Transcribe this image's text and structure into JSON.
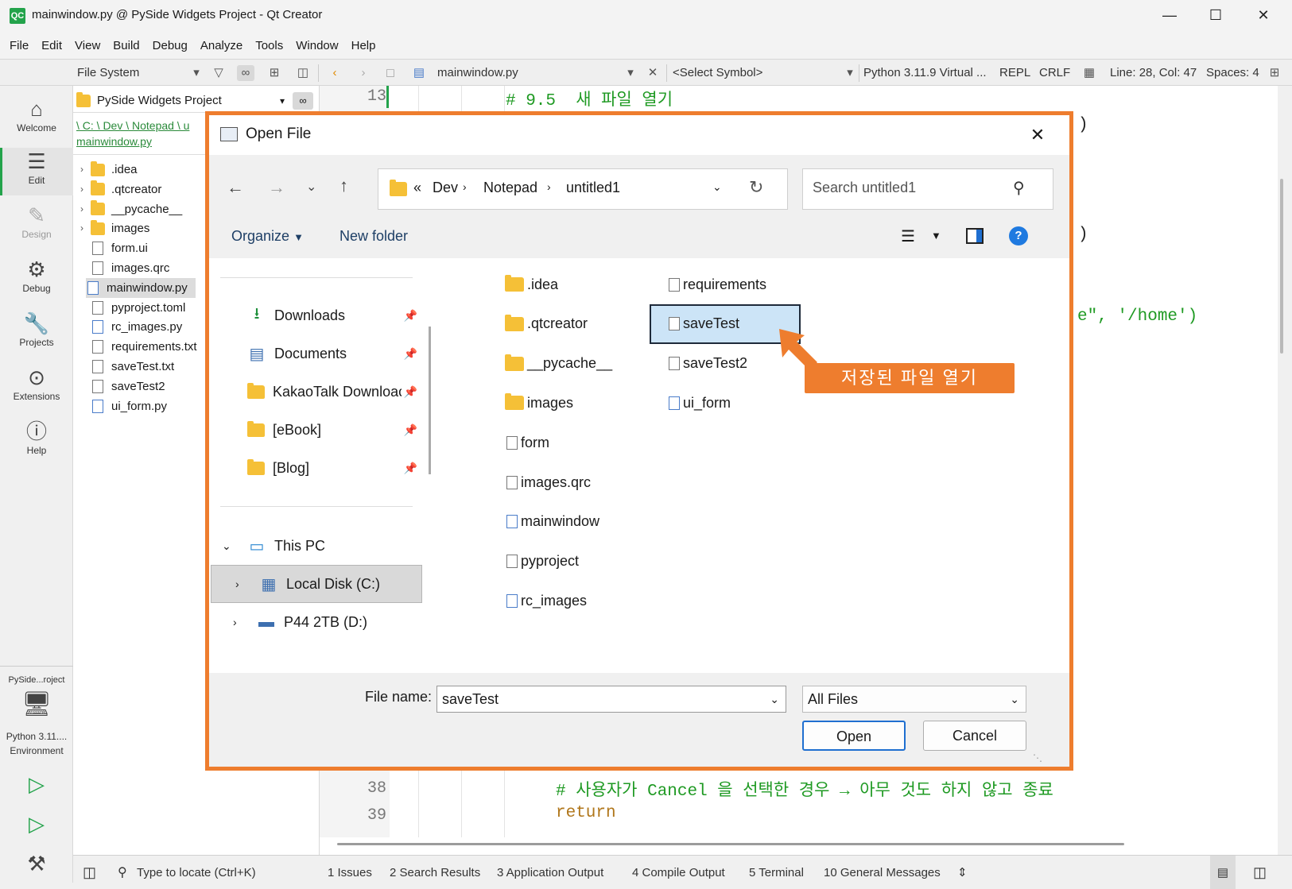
{
  "window": {
    "title": "mainwindow.py @ PySide Widgets Project - Qt Creator",
    "logo": "QC"
  },
  "menu": [
    "File",
    "Edit",
    "View",
    "Build",
    "Debug",
    "Analyze",
    "Tools",
    "Window",
    "Help"
  ],
  "toolbar": {
    "filesystem_label": "File System",
    "file_tab": "mainwindow.py",
    "symbol": "<Select Symbol>",
    "python_env": "Python 3.11.9 Virtual ...",
    "repl": "REPL",
    "line_ending": "CRLF",
    "cursor": "Line: 28, Col: 47",
    "spaces": "Spaces: 4"
  },
  "modes": [
    {
      "label": "Welcome",
      "icon": "home-icon"
    },
    {
      "label": "Edit",
      "icon": "edit-icon"
    },
    {
      "label": "Design",
      "icon": "design-icon"
    },
    {
      "label": "Debug",
      "icon": "bug-icon"
    },
    {
      "label": "Projects",
      "icon": "wrench-icon"
    },
    {
      "label": "Extensions",
      "icon": "extensions-icon"
    },
    {
      "label": "Help",
      "icon": "help-icon"
    }
  ],
  "kit": {
    "project": "PySide...roject",
    "env_line1": "Python 3.11....",
    "env_line2": "Environment"
  },
  "sidepanel": {
    "project": "PySide Widgets Project",
    "breadcrumb": "\\ C: \\ Dev \\ Notepad \\ u",
    "breadcrumb_file": "mainwindow.py",
    "items": [
      {
        "name": ".idea",
        "type": "folder"
      },
      {
        "name": ".qtcreator",
        "type": "folder"
      },
      {
        "name": "__pycache__",
        "type": "folder"
      },
      {
        "name": "images",
        "type": "folder"
      },
      {
        "name": "form.ui",
        "type": "file"
      },
      {
        "name": "images.qrc",
        "type": "file"
      },
      {
        "name": "mainwindow.py",
        "type": "py"
      },
      {
        "name": "pyproject.toml",
        "type": "file"
      },
      {
        "name": "rc_images.py",
        "type": "py"
      },
      {
        "name": "requirements.txt",
        "type": "file"
      },
      {
        "name": "saveTest.txt",
        "type": "file"
      },
      {
        "name": "saveTest2",
        "type": "file"
      },
      {
        "name": "ui_form.py",
        "type": "py"
      }
    ]
  },
  "editor": {
    "line13_num": "13",
    "line13_code": "# 9.5  새 파일 열기",
    "frag_paren1": ")",
    "frag_paren2": ")",
    "frag_home": "e\", '/home')",
    "line38_num": "38",
    "line38_code": "# 사용자가 Cancel 을 선택한 경우 → 아무 것도 하지 않고 종료",
    "line39_num": "39",
    "line39_code": "return"
  },
  "dialog": {
    "title": "Open File",
    "path": [
      "Dev",
      "Notepad",
      "untitled1"
    ],
    "path_prefix": "«",
    "search_placeholder": "Search untitled1",
    "organize": "Organize",
    "new_folder": "New folder",
    "nav": [
      {
        "label": "Downloads",
        "icon": "download-icon",
        "pinned": true
      },
      {
        "label": "Documents",
        "icon": "documents-icon",
        "pinned": true
      },
      {
        "label": "KakaoTalk Downloac",
        "icon": "folder-icon",
        "pinned": true
      },
      {
        "label": "[eBook]",
        "icon": "folder-icon",
        "pinned": true
      },
      {
        "label": "[Blog]",
        "icon": "folder-icon",
        "pinned": true
      },
      {
        "label": "This PC",
        "icon": "pc-icon",
        "pinned": false
      },
      {
        "label": "Local Disk (C:)",
        "icon": "disk-icon",
        "pinned": false
      },
      {
        "label": "P44 2TB (D:)",
        "icon": "drive-icon",
        "pinned": false
      }
    ],
    "files_col1": [
      {
        "name": ".idea",
        "type": "folder"
      },
      {
        "name": ".qtcreator",
        "type": "folder"
      },
      {
        "name": "__pycache__",
        "type": "folder"
      },
      {
        "name": "images",
        "type": "folder"
      },
      {
        "name": "form",
        "type": "file"
      },
      {
        "name": "images.qrc",
        "type": "file"
      },
      {
        "name": "mainwindow",
        "type": "py"
      },
      {
        "name": "pyproject",
        "type": "file"
      },
      {
        "name": "rc_images",
        "type": "py"
      }
    ],
    "files_col2": [
      {
        "name": "requirements",
        "type": "file"
      },
      {
        "name": "saveTest",
        "type": "file",
        "selected": true
      },
      {
        "name": "saveTest2",
        "type": "file"
      },
      {
        "name": "ui_form",
        "type": "py"
      }
    ],
    "filename_label": "File name:",
    "filename_value": "saveTest",
    "filter": "All Files",
    "open": "Open",
    "cancel": "Cancel"
  },
  "annotation": "저장된 파일 열기",
  "statusbar": {
    "locate": "Type to locate (Ctrl+K)",
    "tabs": [
      "1  Issues",
      "2  Search Results",
      "3  Application Output",
      "4  Compile Output",
      "5  Terminal",
      "10  General Messages"
    ]
  },
  "colors": {
    "accent": "#ee7d2e",
    "code_green": "#1f9a23",
    "qt_green": "#23a34b",
    "link_green": "#2a8a3a"
  }
}
